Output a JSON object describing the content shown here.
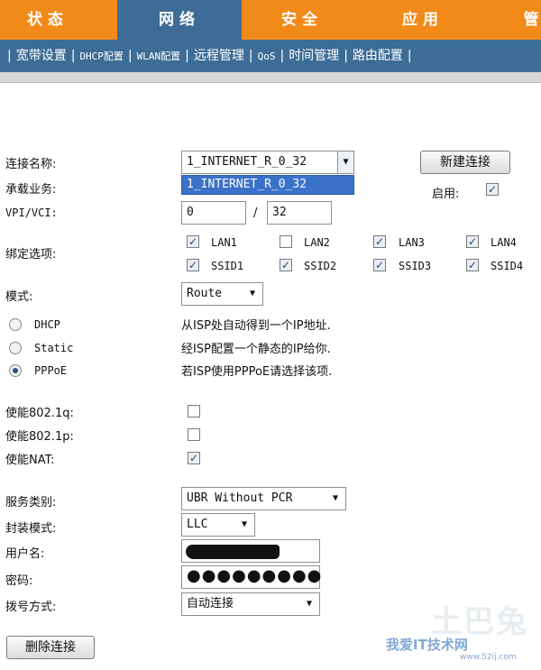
{
  "topnav": {
    "tabs": [
      {
        "label": "状态"
      },
      {
        "label": "网络"
      },
      {
        "label": "安全"
      },
      {
        "label": "应用"
      },
      {
        "label": "管"
      }
    ]
  },
  "subnav": {
    "items": [
      "宽带设置",
      "DHCP配置",
      "WLAN配置",
      "远程管理",
      "QoS",
      "时间管理",
      "路由配置"
    ]
  },
  "form": {
    "conn_name_label": "连接名称:",
    "conn_name_value": "1_INTERNET_R_0_32",
    "dropdown_option": "1_INTERNET_R_0_32",
    "new_conn_button": "新建连接",
    "service_label": "承载业务:",
    "enable_label": "启用:",
    "vpivci_label": "VPI/VCI:",
    "vpi_value": "0",
    "vci_separator": "/",
    "vci_value": "32",
    "binding_label": "绑定选项:",
    "binding": [
      {
        "label": "LAN1",
        "checked": true
      },
      {
        "label": "LAN2",
        "checked": false
      },
      {
        "label": "LAN3",
        "checked": true
      },
      {
        "label": "LAN4",
        "checked": true
      },
      {
        "label": "SSID1",
        "checked": true
      },
      {
        "label": "SSID2",
        "checked": true
      },
      {
        "label": "SSID3",
        "checked": true
      },
      {
        "label": "SSID4",
        "checked": true
      }
    ],
    "mode_label": "模式:",
    "mode_value": "Route",
    "modes": [
      {
        "label": "DHCP",
        "desc": "从ISP处自动得到一个IP地址.",
        "selected": false
      },
      {
        "label": "Static",
        "desc": "经ISP配置一个静态的IP给你.",
        "selected": false
      },
      {
        "label": "PPPoE",
        "desc": "若ISP使用PPPoE请选择该项.",
        "selected": true
      }
    ],
    "dot1q_label": "使能802.1q:",
    "dot1p_label": "使能802.1p:",
    "nat_label": "使能NAT:",
    "service_class_label": "服务类别:",
    "service_class_value": "UBR Without PCR",
    "encap_label": "封装模式:",
    "encap_value": "LLC",
    "username_label": "用户名:",
    "password_label": "密码:",
    "password_value": "●●●●●●●●●",
    "dial_label": "拨号方式:",
    "dial_value": "自动连接",
    "delete_button": "删除连接"
  },
  "watermark": {
    "line1": "土巴兔",
    "line2": "我爱IT技术网",
    "line3": "www.52ij.com"
  }
}
